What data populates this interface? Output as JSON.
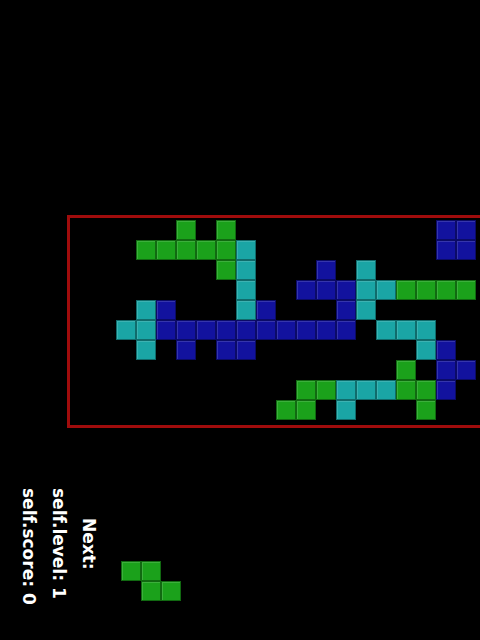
{
  "score": {
    "label": "self.score: 0"
  },
  "level": {
    "label": "self.level: 1"
  },
  "board": {
    "colors": {
      "G": "#1ba11b",
      "C": "#1aa5a5",
      "B": "#12129e"
    },
    "rows": [
      ".....G.G..........BB",
      "...GGGGGC.........BB",
      ".......GC...B.C.....",
      "........C..BBBCCGGGG",
      "...CB...CB...BC.....",
      "..CCBBBBBBBBBB.CCC..",
      "...C.B.BB........CB.",
      "................G.BB",
      "...........GGCCCGGB.",
      "..........GG.C...G.."
    ]
  },
  "next": {
    "label": "Next:",
    "cells": [
      "GG.",
      ".GG"
    ]
  }
}
